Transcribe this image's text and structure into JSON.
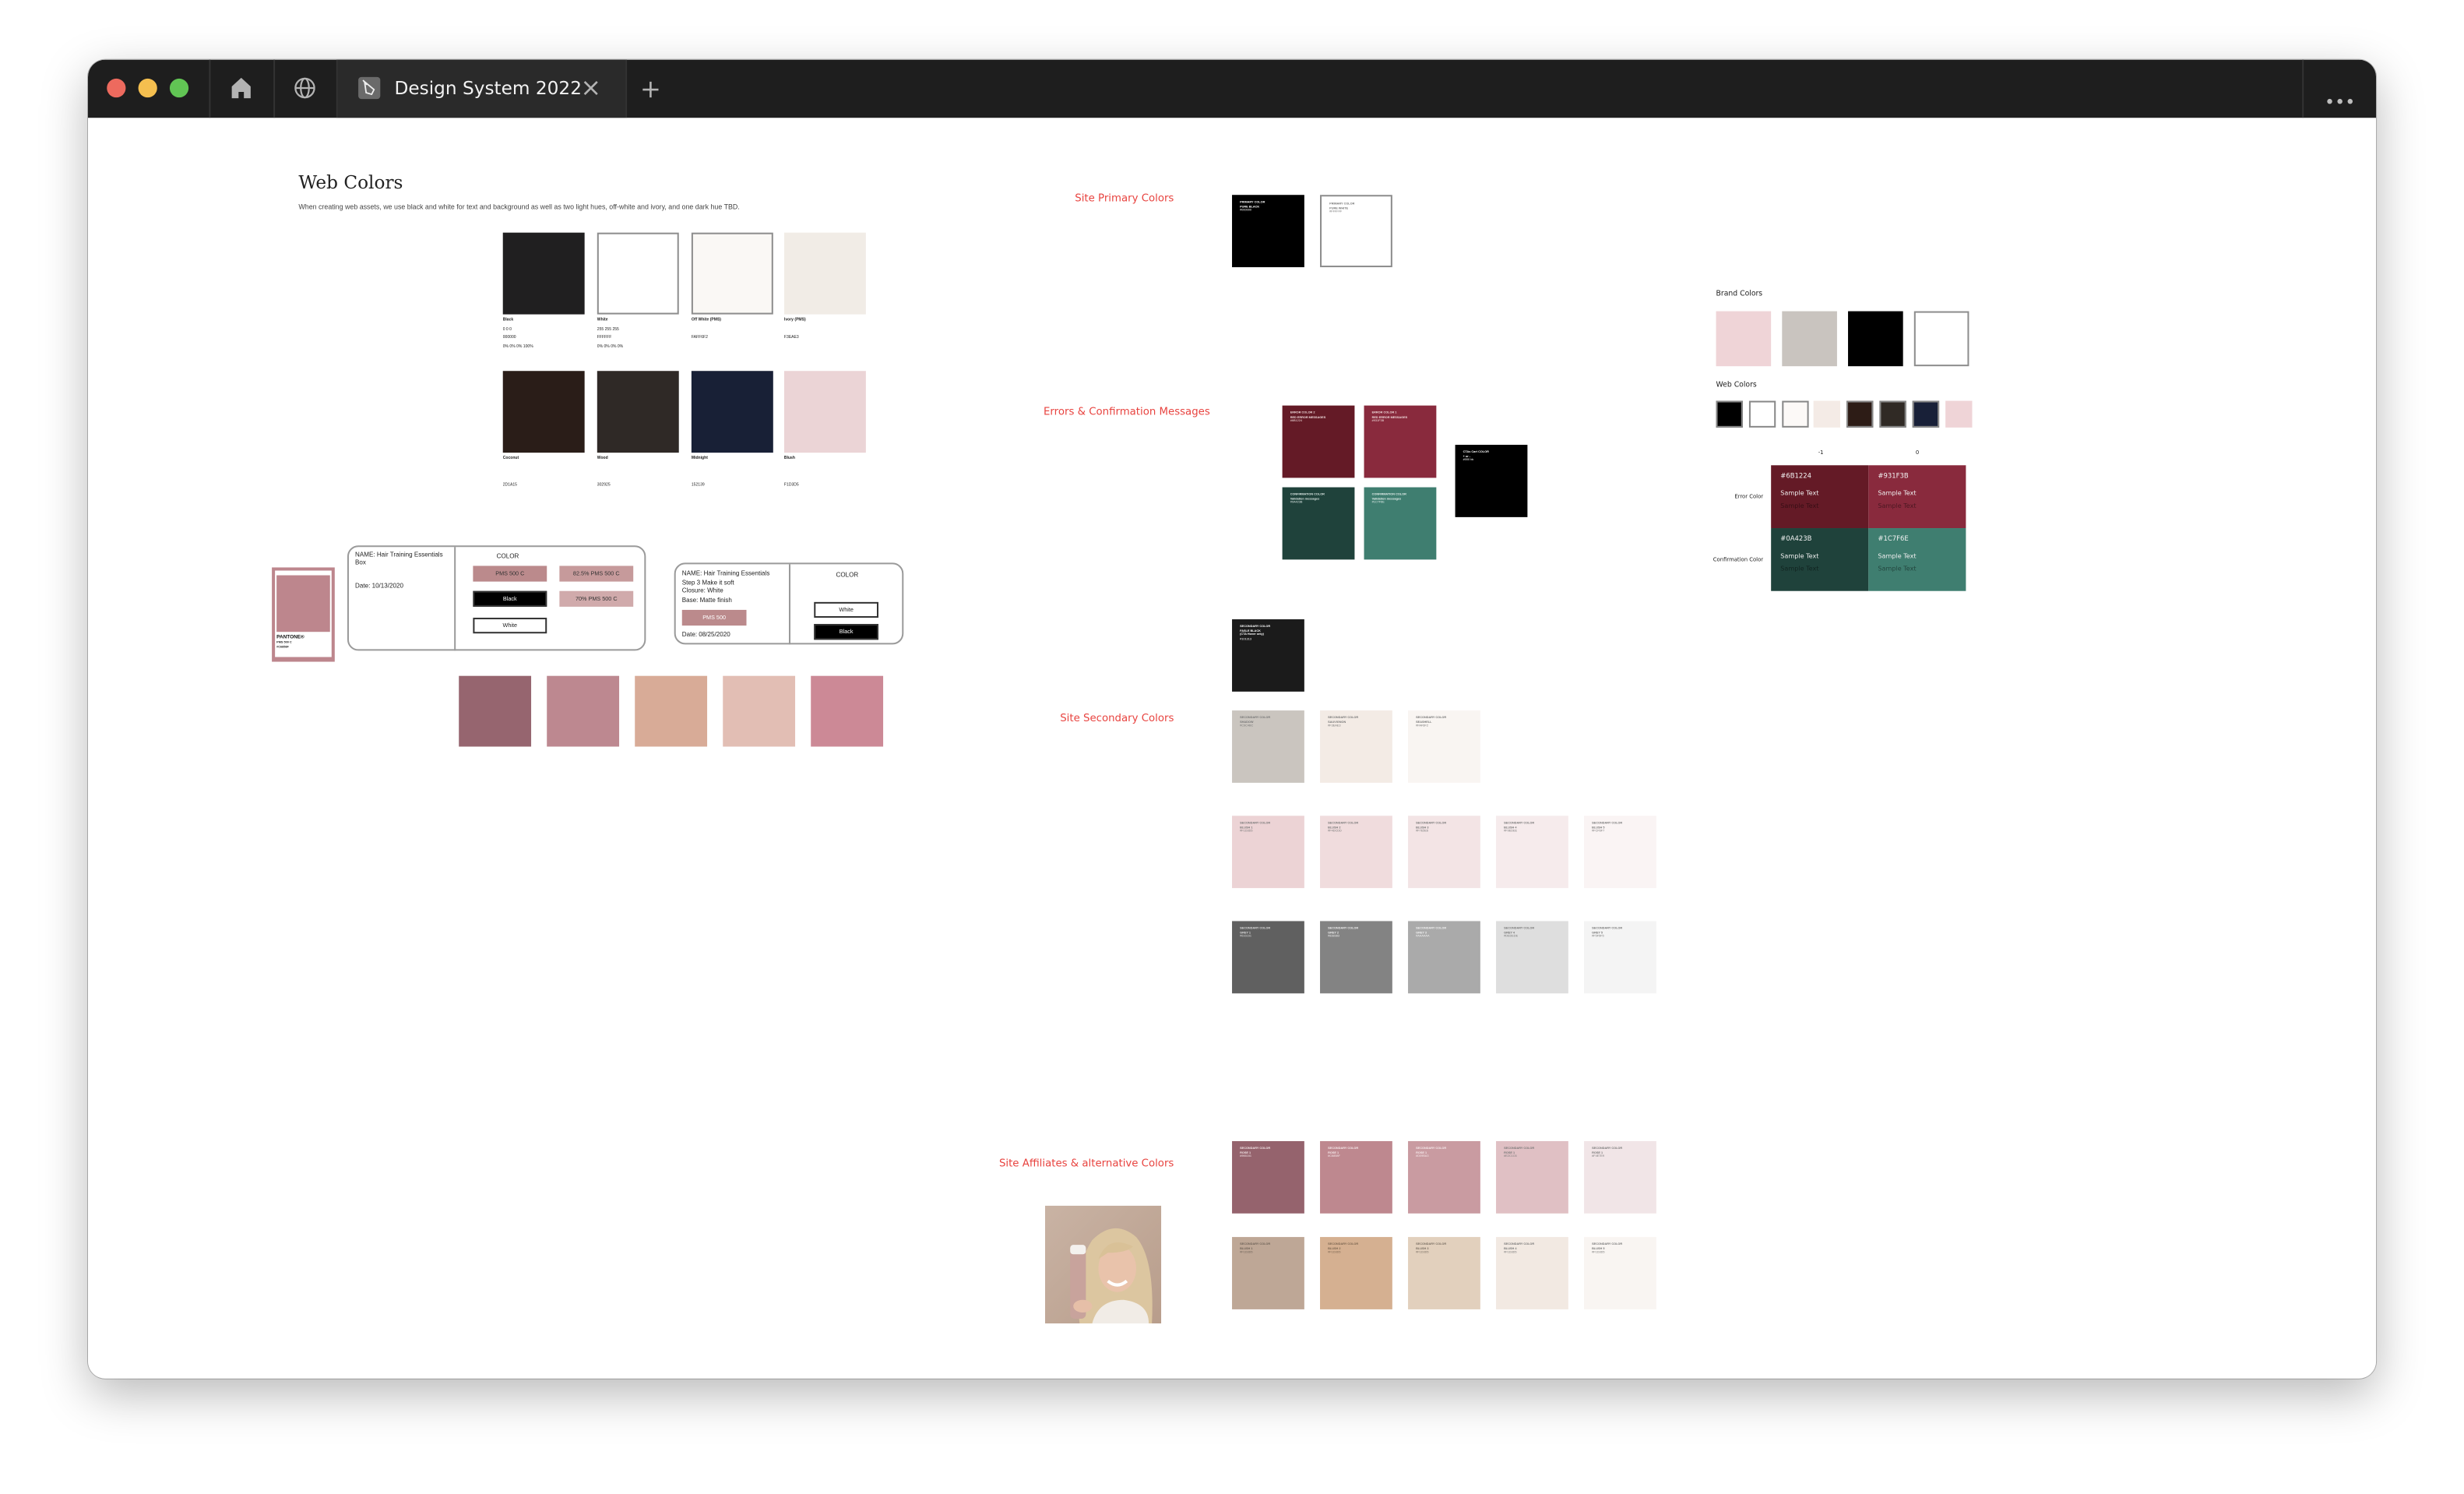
{
  "window": {
    "tab_title": "Design System 2022",
    "traffic_lights": [
      "#ed6a5e",
      "#f5bf4f",
      "#61c554"
    ],
    "icons": [
      "home-icon",
      "globe-icon",
      "pen-nib-icon",
      "close-icon",
      "plus-icon",
      "more-icon"
    ]
  },
  "web_colors": {
    "title": "Web Colors",
    "description": "When creating web assets, we use black and white for text and background as well as two light hues, off-white and ivory, and one dark hue TBD.",
    "swatches": [
      {
        "name": "Black",
        "lines": [
          "0 0 0",
          "000000",
          "0% 0% 0% 100%"
        ],
        "color": "#201f20"
      },
      {
        "name": "White",
        "lines": [
          "255 255 255",
          "FFFFFF",
          "0% 0% 0% 0%"
        ],
        "color": "#ffffff"
      },
      {
        "name": "Off White (PMS)",
        "lines": [
          "",
          "FAFF6F2"
        ],
        "color": "#faf8f5"
      },
      {
        "name": "Ivory (PMS)",
        "lines": [
          "",
          "F3EAE3"
        ],
        "color": "#f1ece6"
      },
      {
        "name": "Coconut",
        "lines": [
          "",
          "2D1A15"
        ],
        "color": "#2a1d18"
      },
      {
        "name": "Wood",
        "lines": [
          "",
          "302925"
        ],
        "color": "#2f2926"
      },
      {
        "name": "Midnight",
        "lines": [
          "",
          "152139"
        ],
        "color": "#182036"
      },
      {
        "name": "Blush",
        "lines": [
          "",
          "F1D3D5"
        ],
        "color": "#ebd4d6"
      }
    ]
  },
  "pantone": {
    "brand": "PANTONE®",
    "code": "PMS 500 C",
    "hex": "#C6858F",
    "color": "#bd868d"
  },
  "spec_card_1": {
    "name_lines": [
      "NAME: Hair Training Essentials",
      "Box"
    ],
    "date": "Date: 10/13/2020",
    "color_label": "COLOR",
    "chips": [
      {
        "label": "PMS 500 C",
        "color": "#bb8a8c",
        "text_color": "#333333"
      },
      {
        "label": "82.5% PMS 500 C",
        "color": "#c69a9b",
        "text_color": "#333333"
      },
      {
        "label": "Black",
        "color": "#000000",
        "text_color": "#ffffff"
      },
      {
        "label": "70% PMS 500 C",
        "color": "#d0aaab",
        "text_color": "#333333"
      },
      {
        "label": "White",
        "color": "#ffffff",
        "text_color": "#222222"
      }
    ]
  },
  "spec_card_2": {
    "name_lines": [
      "NAME: Hair Training Essentials",
      "Step 3 Make it soft",
      "Closure: White",
      "Base: Matte finish"
    ],
    "chip": {
      "label": "PMS 500",
      "color": "#bb8a8c",
      "text_color": "#ffffff"
    },
    "date": "Date: 08/25/2020",
    "color_label": "COLOR",
    "chips": [
      {
        "label": "White",
        "color": "#ffffff",
        "text_color": "#222222"
      },
      {
        "label": "Black",
        "color": "#000000",
        "text_color": "#ffffff"
      }
    ]
  },
  "rose_palette": [
    "#96656f",
    "#bd8890",
    "#d8ab97",
    "#e2beb4",
    "#cc8996"
  ],
  "site_primary": {
    "label": "Site Primary Colors",
    "swatches": [
      {
        "lines": [
          "PRIMARY COLOR",
          "PURE BLACK",
          "#000000"
        ],
        "color": "#000000",
        "text_color": "#ffffff"
      },
      {
        "lines": [
          "PRIMARY COLOR",
          "PURE WHITE",
          "#FFFFFF"
        ],
        "color": "#ffffff",
        "text_color": "#777777"
      }
    ]
  },
  "errors": {
    "label": "Errors & Confirmation Messages",
    "swatches": [
      {
        "lines": [
          "ERROR COLOR 2",
          "RED ERROR MESSAGES",
          "#6B1224"
        ],
        "color": "#641a26",
        "text_color": "#f0dede"
      },
      {
        "lines": [
          "ERROR COLOR 1",
          "RED ERROR MESSAGES",
          "#931F3B"
        ],
        "color": "#892a3d",
        "text_color": "#f0dede"
      },
      {
        "lines": [
          "CONFIRMATION COLOR",
          "Validation messages",
          "#0A423B"
        ],
        "color": "#1f423b",
        "text_color": "#dde8e5"
      },
      {
        "lines": [
          "CONFIRMATION COLOR",
          "Validation messages",
          "#1C7F6E"
        ],
        "color": "#3f7e70",
        "text_color": "#e6f0ed"
      }
    ],
    "cta": {
      "lines": [
        "CTAs Cart COLOR",
        "+ or -",
        "#000 bk"
      ],
      "color": "#000000",
      "text_color": "#ffffff"
    }
  },
  "secondary": {
    "label": "Site Secondary Colors",
    "false_black": {
      "lines": [
        "SECONDARY COLOR",
        "FASLE BLACK",
        "(CTA Hover only)",
        "#101313"
      ],
      "color": "#1b1b1b",
      "text_color": "#ffffff"
    },
    "rows": [
      [
        {
          "lines": [
            "SECONDARY COLOR",
            "SHADOW",
            "#C9C4BC"
          ],
          "color": "#cac5bf",
          "text_color": "#777777"
        },
        {
          "lines": [
            "SECONDARY COLOR",
            "SAUVIGNON",
            "#F3EAE3"
          ],
          "color": "#f3ebe5",
          "text_color": "#777777"
        },
        {
          "lines": [
            "SECONDARY COLOR",
            "SEASHELL",
            "#FAF6F2"
          ],
          "color": "#f9f5f2",
          "text_color": "#777777"
        }
      ],
      [
        {
          "lines": [
            "SECONDARY COLOR",
            "BLUSH 1",
            "#F1D3D5"
          ],
          "color": "#ecd3d5",
          "text_color": "#777777"
        },
        {
          "lines": [
            "SECONDARY COLOR",
            "BLUSH 2",
            "#F4DCDD"
          ],
          "color": "#f0dcdd",
          "text_color": "#777777"
        },
        {
          "lines": [
            "SECONDARY COLOR",
            "BLUSH 3",
            "#F7E5E6"
          ],
          "color": "#f3e4e5",
          "text_color": "#777777"
        },
        {
          "lines": [
            "SECONDARY COLOR",
            "BLUSH 4",
            "#F9EDEE"
          ],
          "color": "#f6ebec",
          "text_color": "#777777"
        },
        {
          "lines": [
            "SECONDARY COLOR",
            "BLUSH 5",
            "#FCF6F7"
          ],
          "color": "#faf4f4",
          "text_color": "#777777"
        }
      ],
      [
        {
          "lines": [
            "SECONDARY COLOR",
            "GREY 1",
            "#616161"
          ],
          "color": "#606060",
          "text_color": "#dddddd"
        },
        {
          "lines": [
            "SECONDARY COLOR",
            "GREY 2",
            "#838383"
          ],
          "color": "#838383",
          "text_color": "#eeeeee"
        },
        {
          "lines": [
            "SECONDARY COLOR",
            "GREY 3",
            "#AAAAAA"
          ],
          "color": "#aaaaaa",
          "text_color": "#f2f2f2"
        },
        {
          "lines": [
            "SECONDARY COLOR",
            "GREY 4",
            "#DEDEDE"
          ],
          "color": "#dedede",
          "text_color": "#777777"
        },
        {
          "lines": [
            "SECONDARY COLOR",
            "GREY 5",
            "#F5F5F5"
          ],
          "color": "#f4f4f4",
          "text_color": "#777777"
        }
      ]
    ]
  },
  "affiliates": {
    "label": "Site Affiliates & alternative Colors",
    "rows": [
      [
        {
          "lines": [
            "SECONDARY COLOR",
            "ROSE 1",
            "#966161"
          ],
          "color": "#95636d",
          "text_color": "#f3e6e8"
        },
        {
          "lines": [
            "SECONDARY COLOR",
            "ROSE 1",
            "#C6858F"
          ],
          "color": "#be888f",
          "text_color": "#f6eaec"
        },
        {
          "lines": [
            "SECONDARY COLOR",
            "ROSE 1",
            "#D09BA3"
          ],
          "color": "#c99ba1",
          "text_color": "#f6eaec"
        },
        {
          "lines": [
            "SECONDARY COLOR",
            "ROSE 1",
            "#E2C1C6"
          ],
          "color": "#e0c0c4",
          "text_color": "#777777"
        },
        {
          "lines": [
            "SECONDARY COLOR",
            "ROSE 1",
            "#F4E7E9"
          ],
          "color": "#f1e5e7",
          "text_color": "#777777"
        }
      ],
      [
        {
          "lines": [
            "SECONDARY COLOR",
            "BLUSH 1",
            "#F1D3D5"
          ],
          "color": "#bea796",
          "text_color": "#6f6358"
        },
        {
          "lines": [
            "SECONDARY COLOR",
            "BLUSH 2",
            "#F1D3D5"
          ],
          "color": "#d5b091",
          "text_color": "#7c6651"
        },
        {
          "lines": [
            "SECONDARY COLOR",
            "BLUSH 3",
            "#F1D3D5"
          ],
          "color": "#e2d0bd",
          "text_color": "#7a6f63"
        },
        {
          "lines": [
            "SECONDARY COLOR",
            "BLUSH 4",
            "#F1D3D5"
          ],
          "color": "#f2e9e2",
          "text_color": "#777777"
        },
        {
          "lines": [
            "SECONDARY COLOR",
            "BLUSH 5",
            "#F1D3D5"
          ],
          "color": "#f9f5f2",
          "text_color": "#777777"
        }
      ]
    ]
  },
  "brand_panel": {
    "brand_label": "Brand Colors",
    "brand_colors": [
      "#efd4d7",
      "#c9c4bf",
      "#000000",
      "#ffffff"
    ],
    "web_label": "Web Colors",
    "web_colors": [
      "#000000",
      "#ffffff",
      "#fcf9f7",
      "#f4ebe6",
      "#2d1c16",
      "#302a25",
      "#182038",
      "#efd4d7"
    ],
    "columns": [
      "-1",
      "0"
    ],
    "rows": [
      {
        "label": "Error Color",
        "cells": [
          {
            "hex": "#6B1224",
            "sample_light": "Sample Text",
            "sample_dark": "Sample Text",
            "color": "#641a26"
          },
          {
            "hex": "#931F3B",
            "sample_light": "Sample Text",
            "sample_dark": "Sample Text",
            "color": "#892a3d"
          }
        ]
      },
      {
        "label": "Confirmation Color",
        "cells": [
          {
            "hex": "#0A423B",
            "sample_light": "Sample Text",
            "sample_dark": "Sample Text",
            "color": "#1f423b"
          },
          {
            "hex": "#1C7F6E",
            "sample_light": "Sample Text",
            "sample_dark": "Sample Text",
            "color": "#3f7e70"
          }
        ]
      }
    ]
  }
}
